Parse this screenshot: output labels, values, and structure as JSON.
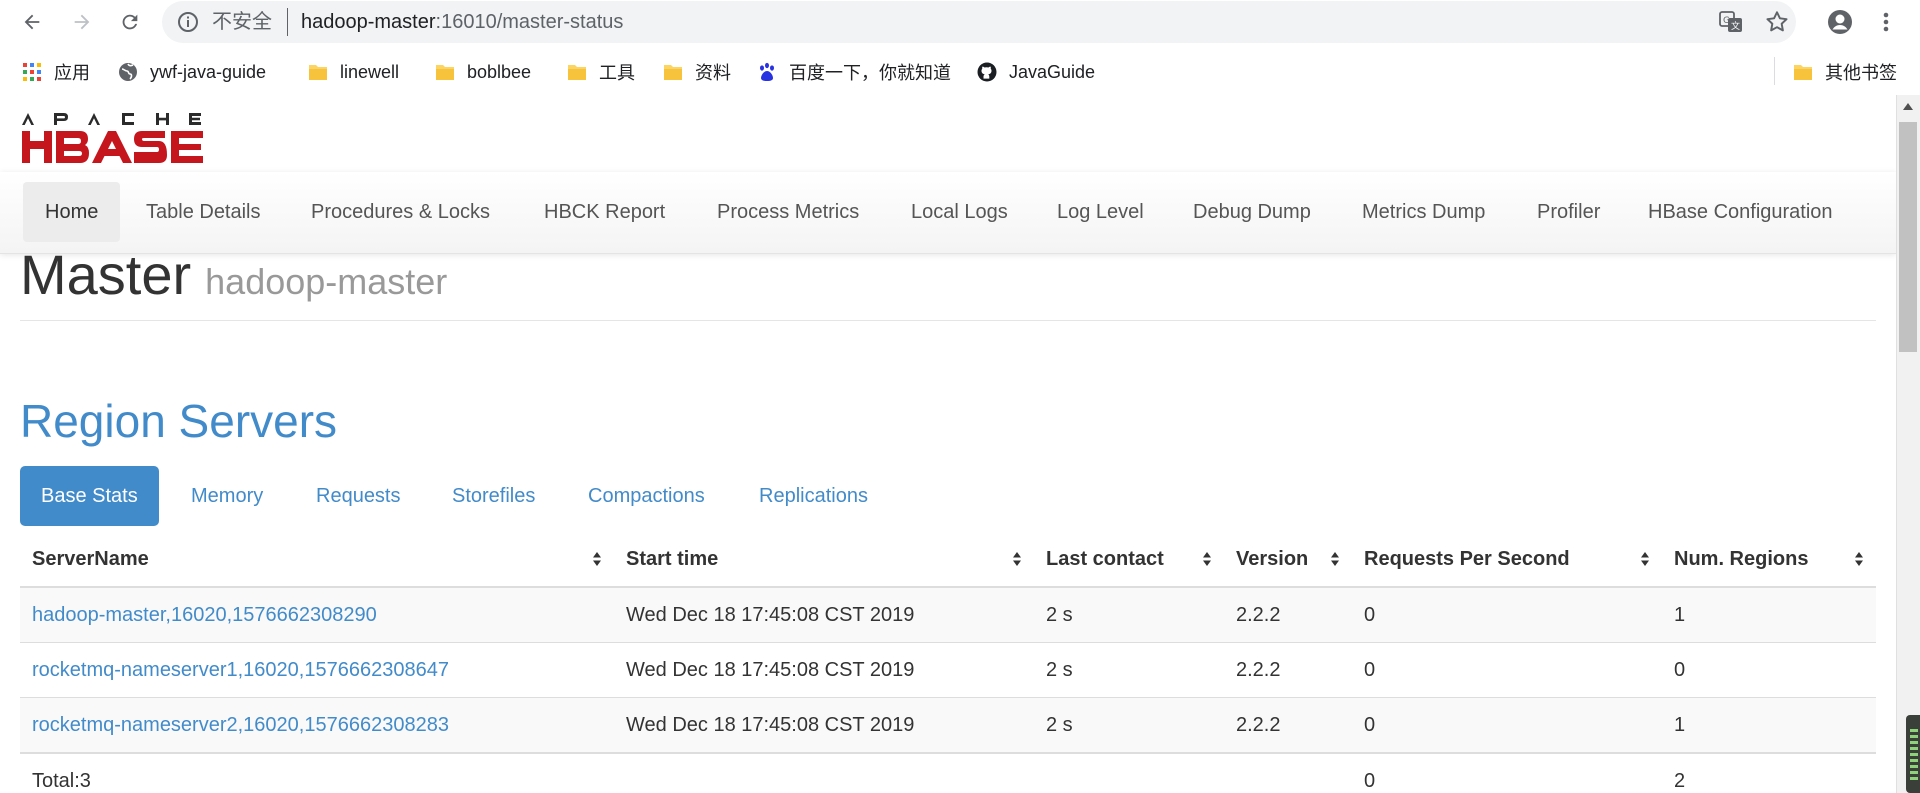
{
  "browser": {
    "insecure_label": "不安全",
    "url_host": "hadoop-master",
    "url_path": ":16010/master-status"
  },
  "bookmarks": {
    "items": [
      {
        "label": "应用",
        "icon": "apps-grid-icon"
      },
      {
        "label": "ywf-java-guide",
        "icon": "globe-icon"
      },
      {
        "label": "linewell",
        "icon": "folder-icon"
      },
      {
        "label": "boblbee",
        "icon": "folder-icon"
      },
      {
        "label": "工具",
        "icon": "folder-icon"
      },
      {
        "label": "资料",
        "icon": "folder-icon"
      },
      {
        "label": "百度一下，你就知道",
        "icon": "baidu-paw-icon"
      },
      {
        "label": "JavaGuide",
        "icon": "github-icon"
      }
    ],
    "other": "其他书签"
  },
  "nav": {
    "items": [
      "Home",
      "Table Details",
      "Procedures & Locks",
      "HBCK Report",
      "Process Metrics",
      "Local Logs",
      "Log Level",
      "Debug Dump",
      "Metrics Dump",
      "Profiler",
      "HBase Configuration"
    ],
    "active": "Home"
  },
  "header": {
    "title": "Master",
    "host": "hadoop-master"
  },
  "region_servers": {
    "title": "Region Servers",
    "tabs": [
      "Base Stats",
      "Memory",
      "Requests",
      "Storefiles",
      "Compactions",
      "Replications"
    ],
    "active_tab": "Base Stats",
    "columns": [
      "ServerName",
      "Start time",
      "Last contact",
      "Version",
      "Requests Per Second",
      "Num. Regions"
    ],
    "rows": [
      [
        "hadoop-master,16020,1576662308290",
        "Wed Dec 18 17:45:08 CST 2019",
        "2 s",
        "2.2.2",
        "0",
        "1"
      ],
      [
        "rocketmq-nameserver1,16020,1576662308647",
        "Wed Dec 18 17:45:08 CST 2019",
        "2 s",
        "2.2.2",
        "0",
        "0"
      ],
      [
        "rocketmq-nameserver2,16020,1576662308283",
        "Wed Dec 18 17:45:08 CST 2019",
        "2 s",
        "2.2.2",
        "0",
        "1"
      ]
    ],
    "total": {
      "label": "Total:3",
      "requests": "0",
      "regions": "2"
    }
  },
  "colors": {
    "link": "#428bca",
    "active_tab_bg": "#428bca",
    "hbase_red": "#c4161c"
  }
}
